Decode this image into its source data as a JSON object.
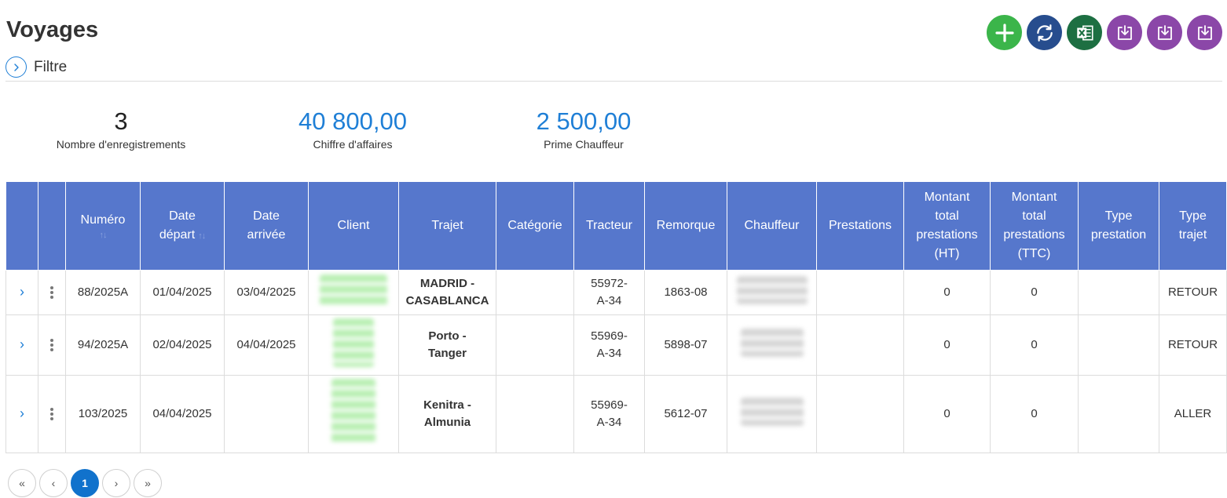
{
  "page": {
    "title": "Voyages"
  },
  "filter": {
    "label": "Filtre"
  },
  "toolbar": {
    "buttons": [
      {
        "name": "add",
        "icon": "plus-icon",
        "color": "#3bb54a"
      },
      {
        "name": "refresh",
        "icon": "refresh-icon",
        "color": "#274d8e"
      },
      {
        "name": "excel",
        "icon": "excel-icon",
        "color": "#1d6f42"
      },
      {
        "name": "download-1",
        "icon": "download-icon",
        "color": "#8b47a8"
      },
      {
        "name": "download-2",
        "icon": "download-icon",
        "color": "#8b47a8"
      },
      {
        "name": "download-3",
        "icon": "download-icon",
        "color": "#8b47a8"
      }
    ]
  },
  "stats": [
    {
      "value": "3",
      "label": "Nombre d'enregistrements",
      "color": "#222222"
    },
    {
      "value": "40 800,00",
      "label": "Chiffre d'affaires",
      "color": "#1f7fd6"
    },
    {
      "value": "2 500,00",
      "label": "Prime Chauffeur",
      "color": "#1f7fd6"
    }
  ],
  "table": {
    "header_color": "#5677cc",
    "columns": {
      "numero": "Numéro",
      "date_depart_1": "Date",
      "date_depart_2": "départ",
      "date_arrivee_1": "Date",
      "date_arrivee_2": "arrivée",
      "client": "Client",
      "trajet": "Trajet",
      "categorie": "Catégorie",
      "tracteur": "Tracteur",
      "remorque": "Remorque",
      "chauffeur": "Chauffeur",
      "prestations": "Prestations",
      "montant_ht_1": "Montant",
      "montant_ht_2": "total",
      "montant_ht_3": "prestations",
      "montant_ht_4": "(HT)",
      "montant_ttc_1": "Montant",
      "montant_ttc_2": "total",
      "montant_ttc_3": "prestations",
      "montant_ttc_4": "(TTC)",
      "type_prestation_1": "Type",
      "type_prestation_2": "prestation",
      "type_trajet_1": "Type",
      "type_trajet_2": "trajet",
      "sort_icon": "↑↓"
    },
    "rows": [
      {
        "numero": "88/2025A",
        "date_depart": "01/04/2025",
        "date_arrivee": "03/04/2025",
        "trajet_1": "MADRID -",
        "trajet_2": "CASABLANCA",
        "categorie": "",
        "tracteur_1": "55972-",
        "tracteur_2": "A-34",
        "remorque": "1863-08",
        "prestations": "",
        "montant_ht": "0",
        "montant_ttc": "0",
        "type_prestation": "",
        "type_trajet": "RETOUR"
      },
      {
        "numero": "94/2025A",
        "date_depart": "02/04/2025",
        "date_arrivee": "04/04/2025",
        "trajet_1": "Porto -",
        "trajet_2": "Tanger",
        "categorie": "",
        "tracteur_1": "55969-",
        "tracteur_2": "A-34",
        "remorque": "5898-07",
        "prestations": "",
        "montant_ht": "0",
        "montant_ttc": "0",
        "type_prestation": "",
        "type_trajet": "RETOUR"
      },
      {
        "numero": "103/2025",
        "date_depart": "04/04/2025",
        "date_arrivee": "",
        "trajet_1": "Kenitra -",
        "trajet_2": "Almunia",
        "categorie": "",
        "tracteur_1": "55969-",
        "tracteur_2": "A-34",
        "remorque": "5612-07",
        "prestations": "",
        "montant_ht": "0",
        "montant_ttc": "0",
        "type_prestation": "",
        "type_trajet": "ALLER"
      }
    ]
  },
  "pagination": {
    "first": "«",
    "prev": "‹",
    "current": "1",
    "next": "›",
    "last": "»"
  }
}
